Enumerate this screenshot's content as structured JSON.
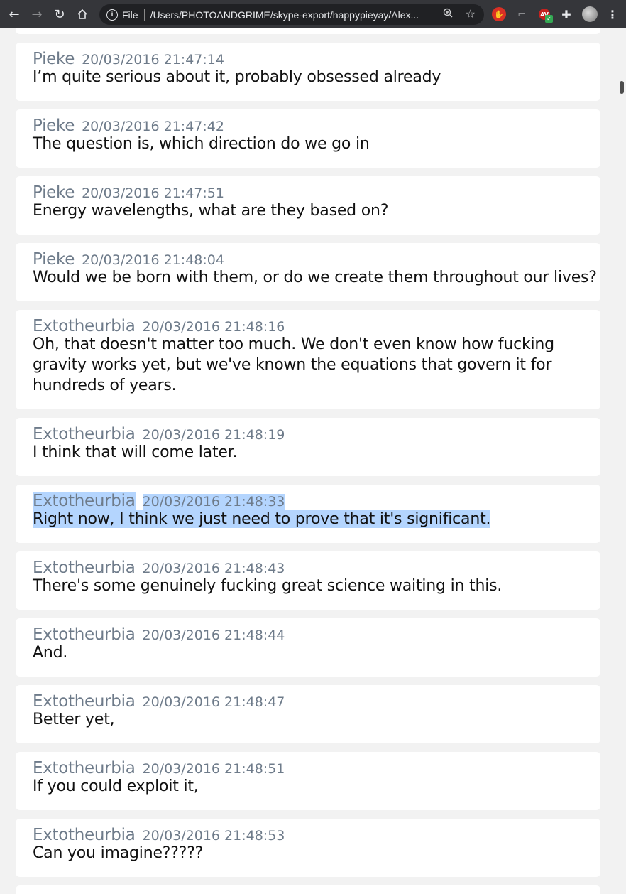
{
  "browser": {
    "scheme_label": "File",
    "url": "/Users/PHOTOANDGRIME/skype-export/happypieyay/Alex..."
  },
  "messages": [
    {
      "author": "Pieke",
      "time": "20/03/2016 21:47:14",
      "text": "I’m quite serious about it, probably obsessed already"
    },
    {
      "author": "Pieke",
      "time": "20/03/2016 21:47:42",
      "text": "The question is, which direction do we go in"
    },
    {
      "author": "Pieke",
      "time": "20/03/2016 21:47:51",
      "text": "Energy wavelengths, what are they based on?"
    },
    {
      "author": "Pieke",
      "time": "20/03/2016 21:48:04",
      "text": "Would we be born with them, or do we create them throughout our lives?"
    },
    {
      "author": "Extotheurbia",
      "time": "20/03/2016 21:48:16",
      "text": "Oh, that doesn't matter too much. We don't even know how fucking gravity works yet, but we've known the equations that govern it for hundreds of years."
    },
    {
      "author": "Extotheurbia",
      "time": "20/03/2016 21:48:19",
      "text": "I think that will come later."
    },
    {
      "author": "Extotheurbia",
      "time": "20/03/2016 21:48:33",
      "text": "Right now, I think we just need to prove that it's significant."
    },
    {
      "author": "Extotheurbia",
      "time": "20/03/2016 21:48:43",
      "text": "There's some genuinely fucking great science waiting in this."
    },
    {
      "author": "Extotheurbia",
      "time": "20/03/2016 21:48:44",
      "text": "And."
    },
    {
      "author": "Extotheurbia",
      "time": "20/03/2016 21:48:47",
      "text": "Better yet,"
    },
    {
      "author": "Extotheurbia",
      "time": "20/03/2016 21:48:51",
      "text": "If you could exploit it,"
    },
    {
      "author": "Extotheurbia",
      "time": "20/03/2016 21:48:53",
      "text": "Can you imagine?????"
    }
  ],
  "colors": {
    "toolbar": "#35363a",
    "omnibox": "#202124",
    "author": "#6e7b8a",
    "selection": "#b4d5fe",
    "page_bg": "#f2f2f2"
  }
}
